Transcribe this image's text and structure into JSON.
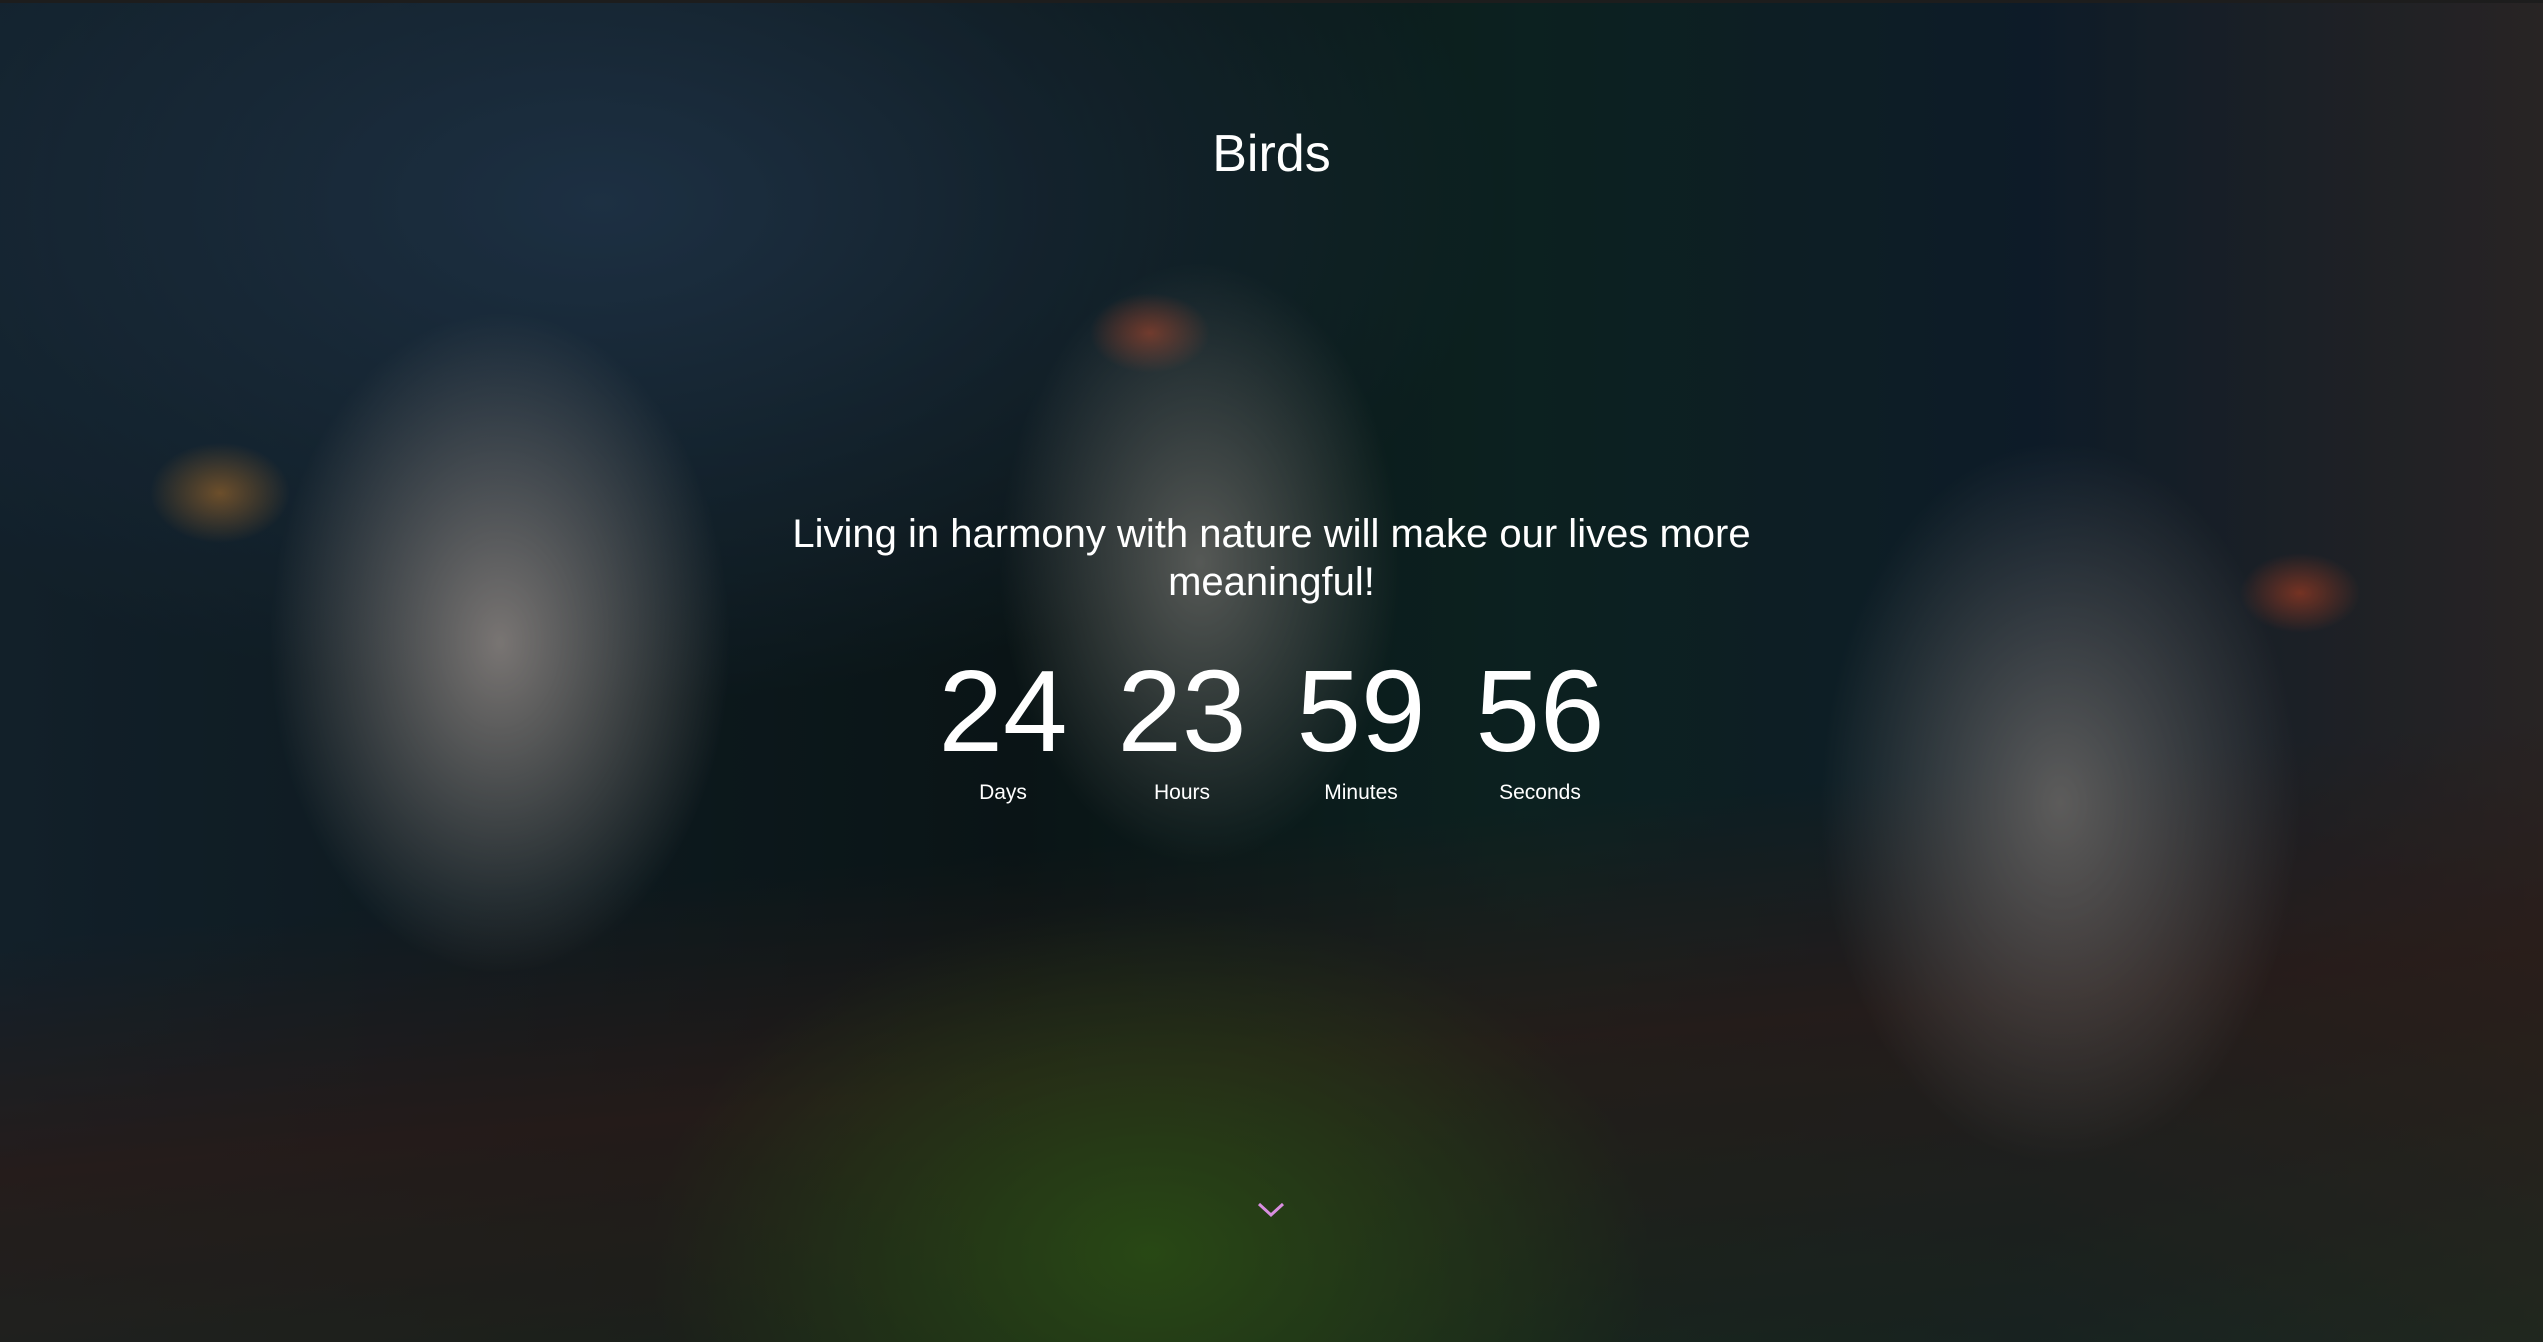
{
  "header": {
    "title": "Birds"
  },
  "hero": {
    "tagline": "Living in harmony with nature will make our lives more meaningful!"
  },
  "countdown": [
    {
      "value": "24",
      "label": "Days"
    },
    {
      "value": "23",
      "label": "Hours"
    },
    {
      "value": "59",
      "label": "Minutes"
    },
    {
      "value": "56",
      "label": "Seconds"
    }
  ],
  "scroll": {
    "icon": "chevron-down-icon",
    "color": "#d98ee0"
  }
}
